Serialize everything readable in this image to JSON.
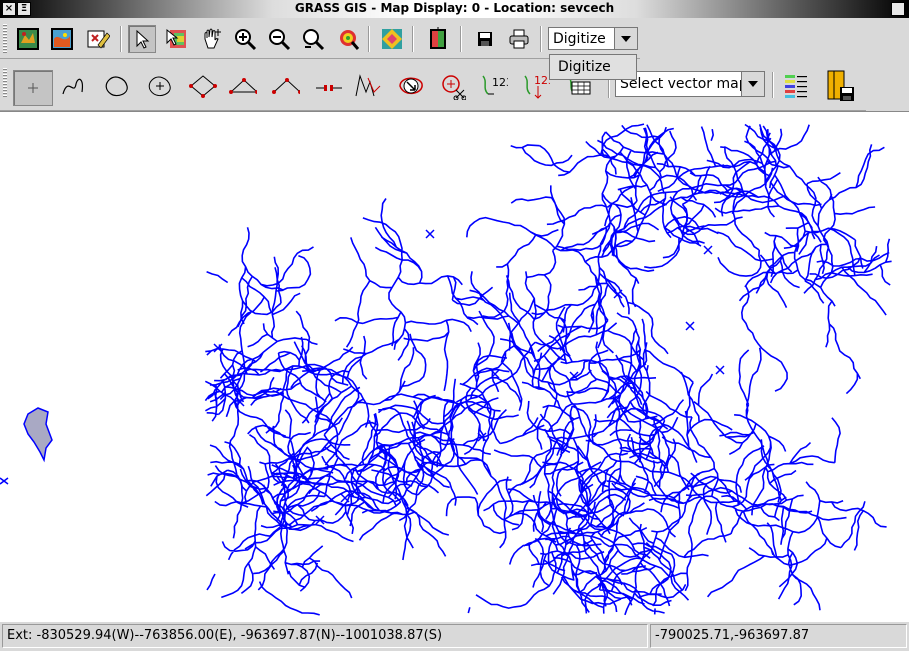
{
  "window": {
    "title": "GRASS GIS - Map Display: 0 - Location: sevcech",
    "close_glyph": "×",
    "menu_glyph": "Ξ"
  },
  "toolbar_main": {
    "buttons": [
      "display-map",
      "render-map",
      "erase-display",
      "pointer",
      "query",
      "pan",
      "zoom-in",
      "zoom-out",
      "zoom-back",
      "zoom-menu",
      "analyze",
      "overlay",
      "save",
      "print"
    ],
    "tool_select": {
      "value": "Digitize",
      "options": [
        "Digitize"
      ]
    }
  },
  "toolbar_digit": {
    "tools": [
      "add-point",
      "add-line",
      "add-boundary",
      "add-centroid",
      "add-vertex",
      "move-vertex",
      "remove-vertex",
      "split-line",
      "edit-line",
      "move-line",
      "delete-line",
      "copy-cats",
      "display-cats",
      "display-attrs"
    ],
    "cats_label": "123",
    "vector_select": {
      "placeholder": "Select vector map"
    }
  },
  "status": {
    "extent": "Ext: -830529.94(W)--763856.00(E), -963697.87(N)--1001038.87(S)",
    "coords": "-790025.71,-963697.87"
  },
  "colors": {
    "vector_lines": "#0000ff",
    "area_fill": "#a9a9c4"
  }
}
